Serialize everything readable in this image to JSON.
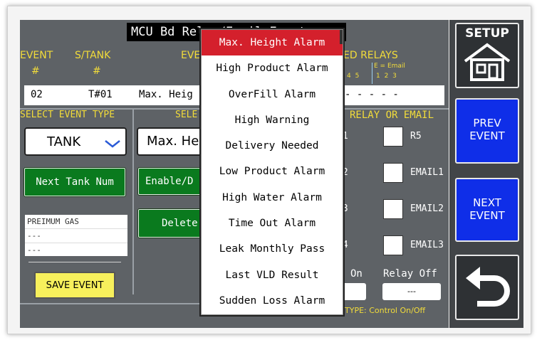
{
  "title": "MCU Bd Relay/Email Events",
  "headers": {
    "event": "EVENT",
    "event_num": "#",
    "stank": "S/TANK",
    "stank_num": "#",
    "event_type": "EVENT T",
    "relays": "ED RELAYS",
    "email_legend": "E = Email",
    "relay_nums": "4 5",
    "email_nums": "1 2 3"
  },
  "event_row": {
    "num": "02",
    "tank": "T#01",
    "type": "Max. Heig",
    "relays": "- - - - -"
  },
  "select_event_type": {
    "label": "SELECT EVENT TYPE",
    "value": "TANK"
  },
  "select_event_label": "SELE",
  "event_select_value": "Max. Hei",
  "buttons": {
    "next_tank": "Next Tank Num",
    "enable_disable": "Enable/D",
    "delete": "Delete",
    "save": "SAVE EVENT"
  },
  "notes": [
    "PREIMUM GAS",
    "---",
    "---"
  ],
  "relay_or_email": {
    "label": "RELAY OR EMAIL",
    "left_labels": [
      "R1",
      "R2",
      "R3",
      "R4"
    ],
    "options": [
      "R5",
      "EMAIL1",
      "EMAIL2",
      "EMAIL3"
    ]
  },
  "relay_on": "On",
  "relay_off": "Relay Off",
  "relay_off_value": "---",
  "type_text": "TYPE: Control On/Off",
  "dropdown": {
    "selected": "Max. Height Alarm",
    "items": [
      "Max. Height Alarm",
      "High Product Alarm",
      "OverFill Alarm",
      "High Warning",
      "Delivery Needed",
      "Low Product Alarm",
      "High Water Alarm",
      "Time Out Alarm",
      "Leak Monthly Pass",
      "Last VLD Result",
      "Sudden Loss Alarm"
    ]
  },
  "sidebar": {
    "setup": "SETUP",
    "prev": [
      "PREV",
      "EVENT"
    ],
    "next": [
      "NEXT",
      "EVENT"
    ]
  },
  "colors": {
    "accent_yellow": "#f2dc3a",
    "button_green": "#0a7a1e",
    "button_blue": "#0f2ee8",
    "highlight_red": "#d4202c"
  }
}
